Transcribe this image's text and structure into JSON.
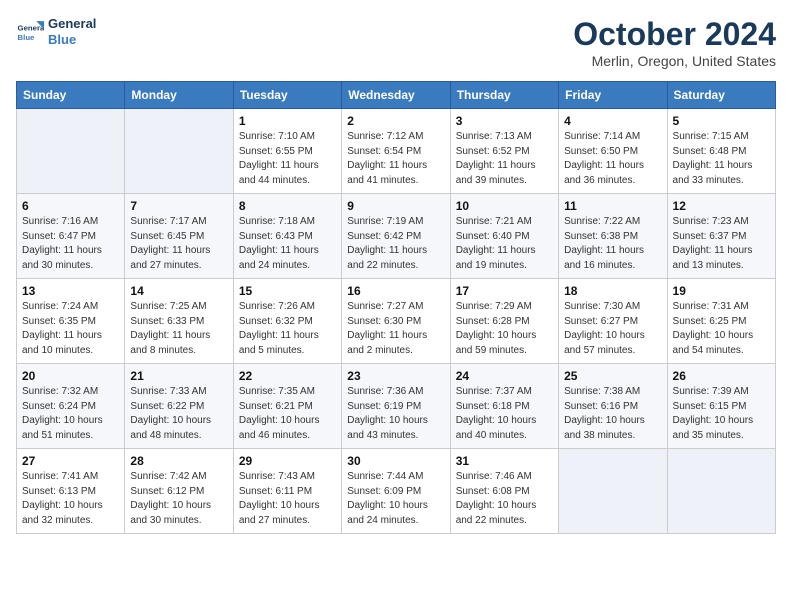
{
  "logo": {
    "line1": "General",
    "line2": "Blue"
  },
  "title": "October 2024",
  "subtitle": "Merlin, Oregon, United States",
  "weekdays": [
    "Sunday",
    "Monday",
    "Tuesday",
    "Wednesday",
    "Thursday",
    "Friday",
    "Saturday"
  ],
  "weeks": [
    [
      {
        "day": "",
        "detail": "",
        "empty": true
      },
      {
        "day": "",
        "detail": "",
        "empty": true
      },
      {
        "day": "1",
        "detail": "Sunrise: 7:10 AM\nSunset: 6:55 PM\nDaylight: 11 hours\nand 44 minutes."
      },
      {
        "day": "2",
        "detail": "Sunrise: 7:12 AM\nSunset: 6:54 PM\nDaylight: 11 hours\nand 41 minutes."
      },
      {
        "day": "3",
        "detail": "Sunrise: 7:13 AM\nSunset: 6:52 PM\nDaylight: 11 hours\nand 39 minutes."
      },
      {
        "day": "4",
        "detail": "Sunrise: 7:14 AM\nSunset: 6:50 PM\nDaylight: 11 hours\nand 36 minutes."
      },
      {
        "day": "5",
        "detail": "Sunrise: 7:15 AM\nSunset: 6:48 PM\nDaylight: 11 hours\nand 33 minutes."
      }
    ],
    [
      {
        "day": "6",
        "detail": "Sunrise: 7:16 AM\nSunset: 6:47 PM\nDaylight: 11 hours\nand 30 minutes."
      },
      {
        "day": "7",
        "detail": "Sunrise: 7:17 AM\nSunset: 6:45 PM\nDaylight: 11 hours\nand 27 minutes."
      },
      {
        "day": "8",
        "detail": "Sunrise: 7:18 AM\nSunset: 6:43 PM\nDaylight: 11 hours\nand 24 minutes."
      },
      {
        "day": "9",
        "detail": "Sunrise: 7:19 AM\nSunset: 6:42 PM\nDaylight: 11 hours\nand 22 minutes."
      },
      {
        "day": "10",
        "detail": "Sunrise: 7:21 AM\nSunset: 6:40 PM\nDaylight: 11 hours\nand 19 minutes."
      },
      {
        "day": "11",
        "detail": "Sunrise: 7:22 AM\nSunset: 6:38 PM\nDaylight: 11 hours\nand 16 minutes."
      },
      {
        "day": "12",
        "detail": "Sunrise: 7:23 AM\nSunset: 6:37 PM\nDaylight: 11 hours\nand 13 minutes."
      }
    ],
    [
      {
        "day": "13",
        "detail": "Sunrise: 7:24 AM\nSunset: 6:35 PM\nDaylight: 11 hours\nand 10 minutes."
      },
      {
        "day": "14",
        "detail": "Sunrise: 7:25 AM\nSunset: 6:33 PM\nDaylight: 11 hours\nand 8 minutes."
      },
      {
        "day": "15",
        "detail": "Sunrise: 7:26 AM\nSunset: 6:32 PM\nDaylight: 11 hours\nand 5 minutes."
      },
      {
        "day": "16",
        "detail": "Sunrise: 7:27 AM\nSunset: 6:30 PM\nDaylight: 11 hours\nand 2 minutes."
      },
      {
        "day": "17",
        "detail": "Sunrise: 7:29 AM\nSunset: 6:28 PM\nDaylight: 10 hours\nand 59 minutes."
      },
      {
        "day": "18",
        "detail": "Sunrise: 7:30 AM\nSunset: 6:27 PM\nDaylight: 10 hours\nand 57 minutes."
      },
      {
        "day": "19",
        "detail": "Sunrise: 7:31 AM\nSunset: 6:25 PM\nDaylight: 10 hours\nand 54 minutes."
      }
    ],
    [
      {
        "day": "20",
        "detail": "Sunrise: 7:32 AM\nSunset: 6:24 PM\nDaylight: 10 hours\nand 51 minutes."
      },
      {
        "day": "21",
        "detail": "Sunrise: 7:33 AM\nSunset: 6:22 PM\nDaylight: 10 hours\nand 48 minutes."
      },
      {
        "day": "22",
        "detail": "Sunrise: 7:35 AM\nSunset: 6:21 PM\nDaylight: 10 hours\nand 46 minutes."
      },
      {
        "day": "23",
        "detail": "Sunrise: 7:36 AM\nSunset: 6:19 PM\nDaylight: 10 hours\nand 43 minutes."
      },
      {
        "day": "24",
        "detail": "Sunrise: 7:37 AM\nSunset: 6:18 PM\nDaylight: 10 hours\nand 40 minutes."
      },
      {
        "day": "25",
        "detail": "Sunrise: 7:38 AM\nSunset: 6:16 PM\nDaylight: 10 hours\nand 38 minutes."
      },
      {
        "day": "26",
        "detail": "Sunrise: 7:39 AM\nSunset: 6:15 PM\nDaylight: 10 hours\nand 35 minutes."
      }
    ],
    [
      {
        "day": "27",
        "detail": "Sunrise: 7:41 AM\nSunset: 6:13 PM\nDaylight: 10 hours\nand 32 minutes."
      },
      {
        "day": "28",
        "detail": "Sunrise: 7:42 AM\nSunset: 6:12 PM\nDaylight: 10 hours\nand 30 minutes."
      },
      {
        "day": "29",
        "detail": "Sunrise: 7:43 AM\nSunset: 6:11 PM\nDaylight: 10 hours\nand 27 minutes."
      },
      {
        "day": "30",
        "detail": "Sunrise: 7:44 AM\nSunset: 6:09 PM\nDaylight: 10 hours\nand 24 minutes."
      },
      {
        "day": "31",
        "detail": "Sunrise: 7:46 AM\nSunset: 6:08 PM\nDaylight: 10 hours\nand 22 minutes."
      },
      {
        "day": "",
        "detail": "",
        "empty": true
      },
      {
        "day": "",
        "detail": "",
        "empty": true
      }
    ]
  ]
}
